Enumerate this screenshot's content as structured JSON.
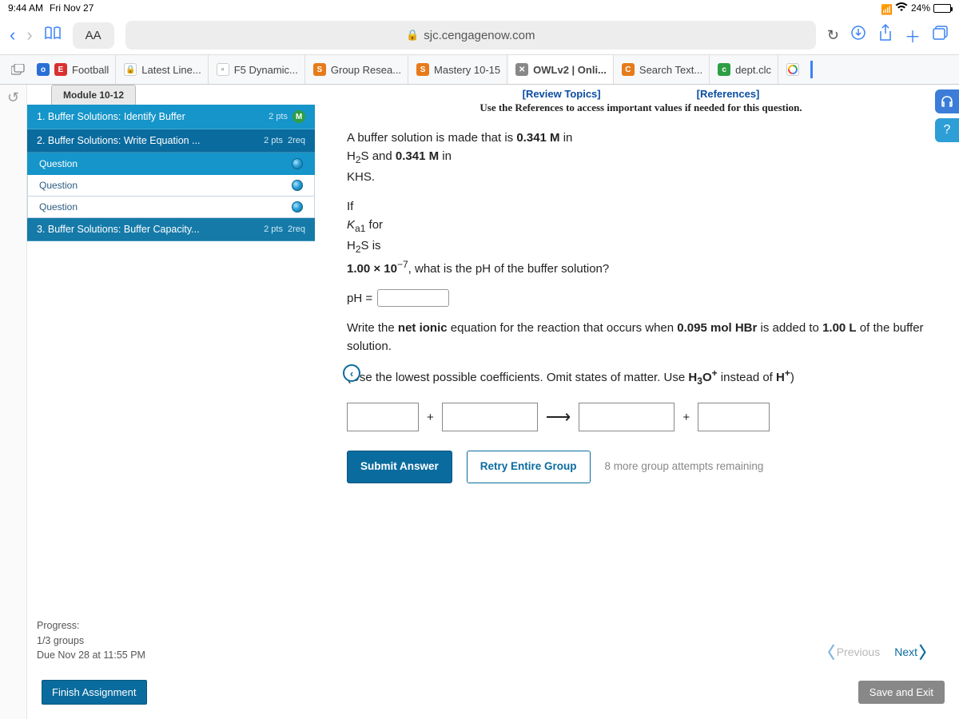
{
  "status": {
    "time": "9:44 AM",
    "date": "Fri Nov 27",
    "battery": "24%"
  },
  "browser": {
    "aa": "AA",
    "url": "sjc.cengagenow.com",
    "tabs": [
      {
        "label": "Football",
        "favicon": "E",
        "cls": "fi-red"
      },
      {
        "label": "Latest Line...",
        "favicon": "🔒",
        "cls": "fi-white"
      },
      {
        "label": "F5 Dynamic...",
        "favicon": "▫",
        "cls": "fi-white"
      },
      {
        "label": "Group Resea...",
        "favicon": "S",
        "cls": "fi-orange"
      },
      {
        "label": "Mastery 10-15",
        "favicon": "S",
        "cls": "fi-orange"
      },
      {
        "label": "OWLv2 | Onli...",
        "favicon": "✕",
        "cls": "fi-grey"
      },
      {
        "label": "Search Text...",
        "favicon": "C",
        "cls": "fi-orange"
      },
      {
        "label": "dept.clc",
        "favicon": "c",
        "cls": "fi-green"
      },
      {
        "label": "",
        "favicon": "G",
        "cls": "fi-gg"
      }
    ]
  },
  "sidebar": {
    "module": "Module 10-12",
    "items": [
      {
        "title": "1. Buffer Solutions: Identify Buffer",
        "pts": "2 pts",
        "badge": "M"
      },
      {
        "title": "2. Buffer Solutions: Write Equation ...",
        "pts": "2 pts",
        "req": "2req",
        "subs": [
          "Question",
          "Question",
          "Question"
        ]
      },
      {
        "title": "3. Buffer Solutions: Buffer Capacity...",
        "pts": "2 pts",
        "req": "2req"
      }
    ]
  },
  "links": {
    "review": "[Review Topics]",
    "refs": "[References]",
    "note": "Use the References to access important values if needed for this question."
  },
  "question": {
    "intro_a": "A buffer solution is made that is ",
    "conc1": "0.341 M",
    "line1b": " in",
    "species1a": "H",
    "species1b": "S and ",
    "conc2": "0.341 M",
    "line2b": " in",
    "species2": "KHS",
    "if": "If",
    "ka_label_a": "K",
    "ka_label_b": " for",
    "ka_species": "H",
    "ka_species2": "S is",
    "ka_val": "1.00 × 10",
    "ka_exp": "−7",
    "ka_tail": ", what is the pH of the buffer solution?",
    "ph_label": "pH =",
    "net_a": "Write the ",
    "net_b": "net ionic",
    "net_c": " equation for the reaction that occurs when ",
    "hbr_amt": "0.095 mol HBr",
    "net_d": " is added to ",
    "vol": "1.00 L",
    "net_e": " of the buffer solution.",
    "coeff_note_a": "(Use the lowest possible coefficients. Omit states of matter. Use ",
    "h3o": "H",
    "h3o_sub": "3",
    "h3o_o": "O",
    "h3o_sup": "+",
    "coeff_note_b": " instead of ",
    "hplus": "H",
    "hplus_sup": "+",
    "coeff_note_c": ")",
    "plus": "+",
    "arrow": "⟶"
  },
  "buttons": {
    "submit": "Submit Answer",
    "retry": "Retry Entire Group",
    "attempts": "8 more group attempts remaining"
  },
  "progress": {
    "label": "Progress:",
    "groups": "1/3 groups",
    "due": "Due Nov 28 at 11:55 PM"
  },
  "nav": {
    "prev": "Previous",
    "next": "Next"
  },
  "footer": {
    "finish": "Finish Assignment",
    "save": "Save and Exit"
  }
}
